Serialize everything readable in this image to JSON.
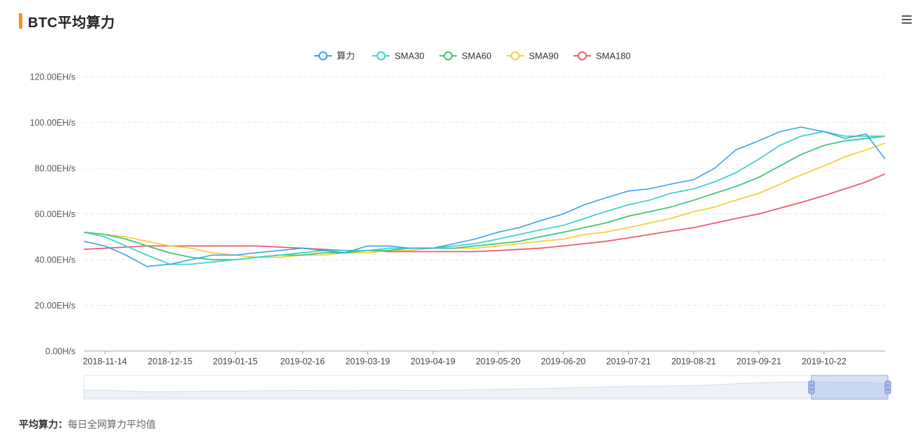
{
  "header": {
    "title": "BTC平均算力"
  },
  "footnote": {
    "label": "平均算力：",
    "text": "每日全网算力平均值"
  },
  "colors": {
    "accent": "#f7931a",
    "hashrate": "#3a9ff2",
    "sma30": "#3fd4c8",
    "sma60": "#3ec77a",
    "sma90": "#f5cf3c",
    "sma180": "#f05a6f"
  },
  "chart_data": {
    "type": "line",
    "title": "BTC平均算力",
    "y_unit": "EH/s",
    "ylim": [
      0,
      120
    ],
    "y_ticks": [
      "0.00H/s",
      "20.00EH/s",
      "40.00EH/s",
      "60.00EH/s",
      "80.00EH/s",
      "100.00EH/s",
      "120.00EH/s"
    ],
    "x_ticks": [
      "2018-11-14",
      "2018-12-15",
      "2019-01-15",
      "2019-02-16",
      "2019-03-19",
      "2019-04-19",
      "2019-05-20",
      "2019-06-20",
      "2019-07-21",
      "2019-08-21",
      "2019-09-21",
      "2019-10-22"
    ],
    "x_range": [
      "2018-11-04",
      "2019-11-20"
    ],
    "grid": true,
    "legend_position": "top-center",
    "dataZoom_range": [
      0.905,
      1.0
    ],
    "series": [
      {
        "name": "算力",
        "color_key": "hashrate",
        "x": [
          "2018-11-04",
          "2018-11-14",
          "2018-11-24",
          "2018-12-04",
          "2018-12-15",
          "2018-12-25",
          "2019-01-04",
          "2019-01-15",
          "2019-01-25",
          "2019-02-05",
          "2019-02-16",
          "2019-02-26",
          "2019-03-08",
          "2019-03-19",
          "2019-03-29",
          "2019-04-08",
          "2019-04-19",
          "2019-04-29",
          "2019-05-09",
          "2019-05-20",
          "2019-05-30",
          "2019-06-09",
          "2019-06-20",
          "2019-06-30",
          "2019-07-10",
          "2019-07-21",
          "2019-07-31",
          "2019-08-10",
          "2019-08-21",
          "2019-08-31",
          "2019-09-10",
          "2019-09-21",
          "2019-10-01",
          "2019-10-11",
          "2019-10-22",
          "2019-11-01",
          "2019-11-11",
          "2019-11-20"
        ],
        "values": [
          48,
          46,
          42,
          37,
          38,
          40,
          42,
          42,
          43,
          44,
          45,
          44,
          43,
          46,
          46,
          45,
          45,
          47,
          49,
          52,
          54,
          57,
          60,
          64,
          67,
          70,
          71,
          73,
          75,
          80,
          88,
          92,
          96,
          98,
          96,
          93,
          95,
          84
        ]
      },
      {
        "name": "SMA30",
        "color_key": "sma30",
        "x": [
          "2018-11-04",
          "2018-11-14",
          "2018-11-24",
          "2018-12-04",
          "2018-12-15",
          "2018-12-25",
          "2019-01-04",
          "2019-01-15",
          "2019-01-25",
          "2019-02-05",
          "2019-02-16",
          "2019-02-26",
          "2019-03-08",
          "2019-03-19",
          "2019-03-29",
          "2019-04-08",
          "2019-04-19",
          "2019-04-29",
          "2019-05-09",
          "2019-05-20",
          "2019-05-30",
          "2019-06-09",
          "2019-06-20",
          "2019-06-30",
          "2019-07-10",
          "2019-07-21",
          "2019-07-31",
          "2019-08-10",
          "2019-08-21",
          "2019-08-31",
          "2019-09-10",
          "2019-09-21",
          "2019-10-01",
          "2019-10-11",
          "2019-10-22",
          "2019-11-01",
          "2019-11-11",
          "2019-11-20"
        ],
        "values": [
          52,
          50,
          46,
          42,
          38,
          38,
          39,
          40,
          41,
          42,
          43,
          44,
          44,
          44,
          45,
          45,
          45,
          46,
          47,
          49,
          51,
          53,
          55,
          58,
          61,
          64,
          66,
          69,
          71,
          74,
          78,
          84,
          90,
          94,
          96,
          94,
          94,
          94
        ]
      },
      {
        "name": "SMA60",
        "color_key": "sma60",
        "x": [
          "2018-11-04",
          "2018-11-14",
          "2018-11-24",
          "2018-12-04",
          "2018-12-15",
          "2018-12-25",
          "2019-01-04",
          "2019-01-15",
          "2019-01-25",
          "2019-02-05",
          "2019-02-16",
          "2019-02-26",
          "2019-03-08",
          "2019-03-19",
          "2019-03-29",
          "2019-04-08",
          "2019-04-19",
          "2019-04-29",
          "2019-05-09",
          "2019-05-20",
          "2019-05-30",
          "2019-06-09",
          "2019-06-20",
          "2019-06-30",
          "2019-07-10",
          "2019-07-21",
          "2019-07-31",
          "2019-08-10",
          "2019-08-21",
          "2019-08-31",
          "2019-09-10",
          "2019-09-21",
          "2019-10-01",
          "2019-10-11",
          "2019-10-22",
          "2019-11-01",
          "2019-11-11",
          "2019-11-20"
        ],
        "values": [
          52,
          51,
          49,
          46,
          43,
          41,
          40,
          40,
          41,
          42,
          42,
          43,
          43,
          44,
          44,
          45,
          45,
          45,
          46,
          47,
          48,
          50,
          52,
          54,
          56,
          59,
          61,
          63,
          66,
          69,
          72,
          76,
          81,
          86,
          90,
          92,
          93,
          94
        ]
      },
      {
        "name": "SMA90",
        "color_key": "sma90",
        "x": [
          "2018-11-04",
          "2018-11-14",
          "2018-11-24",
          "2018-12-04",
          "2018-12-15",
          "2018-12-25",
          "2019-01-04",
          "2019-01-15",
          "2019-01-25",
          "2019-02-05",
          "2019-02-16",
          "2019-02-26",
          "2019-03-08",
          "2019-03-19",
          "2019-03-29",
          "2019-04-08",
          "2019-04-19",
          "2019-04-29",
          "2019-05-09",
          "2019-05-20",
          "2019-05-30",
          "2019-06-09",
          "2019-06-20",
          "2019-06-30",
          "2019-07-10",
          "2019-07-21",
          "2019-07-31",
          "2019-08-10",
          "2019-08-21",
          "2019-08-31",
          "2019-09-10",
          "2019-09-21",
          "2019-10-01",
          "2019-10-11",
          "2019-10-22",
          "2019-11-01",
          "2019-11-11",
          "2019-11-20"
        ],
        "values": [
          52,
          51,
          50,
          48,
          46,
          45,
          43,
          42,
          41,
          41,
          42,
          42,
          43,
          43,
          44,
          44,
          45,
          45,
          45,
          46,
          47,
          48,
          49,
          51,
          52,
          54,
          56,
          58,
          61,
          63,
          66,
          69,
          73,
          77,
          81,
          85,
          88,
          91
        ]
      },
      {
        "name": "SMA180",
        "color_key": "sma180",
        "x": [
          "2018-11-04",
          "2018-11-14",
          "2018-11-24",
          "2018-12-04",
          "2018-12-15",
          "2018-12-25",
          "2019-01-04",
          "2019-01-15",
          "2019-01-25",
          "2019-02-05",
          "2019-02-16",
          "2019-02-26",
          "2019-03-08",
          "2019-03-19",
          "2019-03-29",
          "2019-04-08",
          "2019-04-19",
          "2019-04-29",
          "2019-05-09",
          "2019-05-20",
          "2019-05-30",
          "2019-06-09",
          "2019-06-20",
          "2019-06-30",
          "2019-07-10",
          "2019-07-21",
          "2019-07-31",
          "2019-08-10",
          "2019-08-21",
          "2019-08-31",
          "2019-09-10",
          "2019-09-21",
          "2019-10-01",
          "2019-10-11",
          "2019-10-22",
          "2019-11-01",
          "2019-11-11",
          "2019-11-20"
        ],
        "values": [
          44.5,
          45,
          45.5,
          46,
          46,
          46,
          46,
          46,
          46,
          45.5,
          45,
          44.5,
          44,
          44,
          43.5,
          43.5,
          43.5,
          43.5,
          43.5,
          44,
          44.5,
          45,
          46,
          47,
          48,
          49.5,
          51,
          52.5,
          54,
          56,
          58,
          60,
          62.5,
          65,
          68,
          71,
          74,
          77.5
        ]
      }
    ]
  }
}
